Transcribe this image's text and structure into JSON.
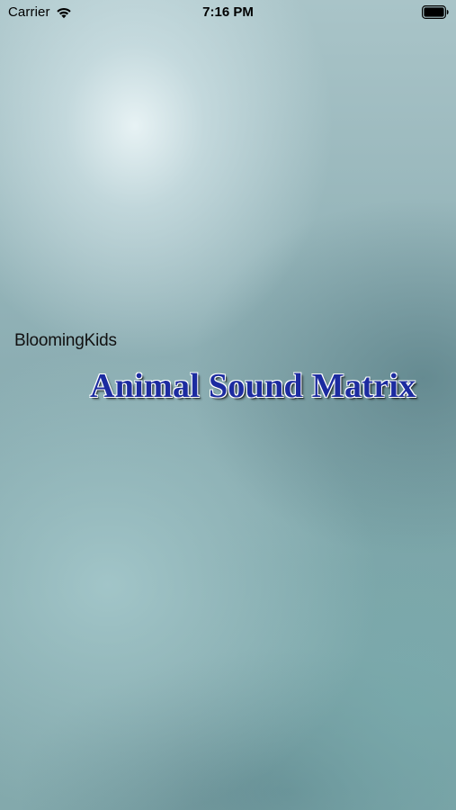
{
  "status_bar": {
    "carrier": "Carrier",
    "time": "7:16 PM",
    "wifi_icon": "wifi-icon",
    "battery_icon": "battery-full-icon"
  },
  "splash": {
    "developer": "BloomingKids",
    "title": "Animal Sound Matrix",
    "title_color": "#1c2ba0"
  }
}
